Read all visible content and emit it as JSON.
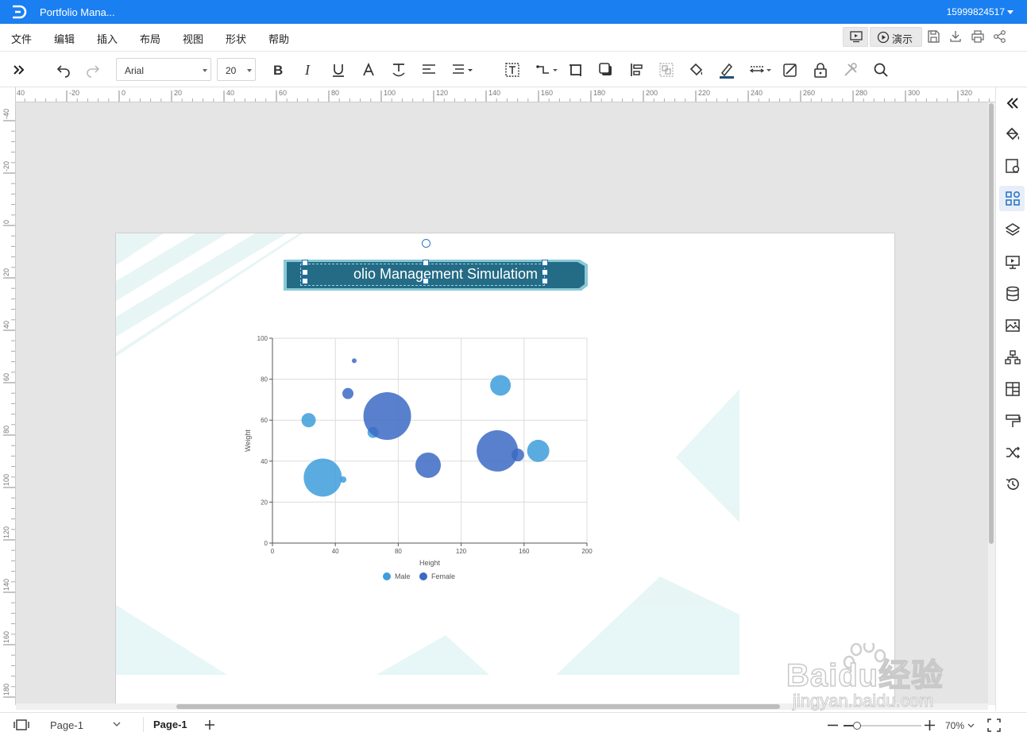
{
  "app": {
    "doc_title": "Portfolio Mana...",
    "account": "15999824517"
  },
  "menu": {
    "items": [
      "文件",
      "编辑",
      "插入",
      "布局",
      "视图",
      "形状",
      "帮助"
    ],
    "present_label": "演示"
  },
  "toolbar": {
    "font_family": "Arial",
    "font_size": "20"
  },
  "rulers": {
    "top_labels": [
      "40",
      "-20",
      "0",
      "20",
      "40",
      "60",
      "80",
      "100",
      "120",
      "140",
      "160",
      "180",
      "200",
      "220",
      "240",
      "260",
      "280",
      "300",
      "320"
    ],
    "left_labels": [
      "-40",
      "-20",
      "0",
      "20",
      "40",
      "60",
      "80",
      "100",
      "120",
      "140",
      "160",
      "180"
    ]
  },
  "slide": {
    "title": "olio Management Simulatiom"
  },
  "chart_data": {
    "type": "scatter",
    "title": "",
    "xlabel": "Height",
    "ylabel": "Weight",
    "xlim": [
      0,
      200
    ],
    "ylim": [
      0,
      100
    ],
    "x_ticks": [
      0,
      40,
      80,
      120,
      160,
      200
    ],
    "y_ticks": [
      0,
      20,
      40,
      60,
      80,
      100
    ],
    "grid": true,
    "legend": "bottom",
    "series": [
      {
        "name": "Male",
        "color": "#3d9ddb",
        "points": [
          {
            "x": 23,
            "y": 60,
            "r": 9
          },
          {
            "x": 32,
            "y": 32,
            "r": 24
          },
          {
            "x": 45,
            "y": 31,
            "r": 4
          },
          {
            "x": 64,
            "y": 54,
            "r": 7
          },
          {
            "x": 145,
            "y": 77,
            "r": 13
          },
          {
            "x": 169,
            "y": 45,
            "r": 14
          }
        ]
      },
      {
        "name": "Female",
        "color": "#3b6ac4",
        "points": [
          {
            "x": 52,
            "y": 89,
            "r": 3
          },
          {
            "x": 48,
            "y": 73,
            "r": 7
          },
          {
            "x": 73,
            "y": 62,
            "r": 30
          },
          {
            "x": 99,
            "y": 38,
            "r": 16
          },
          {
            "x": 143,
            "y": 45,
            "r": 26
          },
          {
            "x": 156,
            "y": 43,
            "r": 8
          }
        ]
      }
    ]
  },
  "statusbar": {
    "page_select": "Page-1",
    "page_tab": "Page-1",
    "zoom": "70%"
  },
  "watermark": {
    "brand": "Baidu经验",
    "url": "jingyan.baidu.com"
  }
}
